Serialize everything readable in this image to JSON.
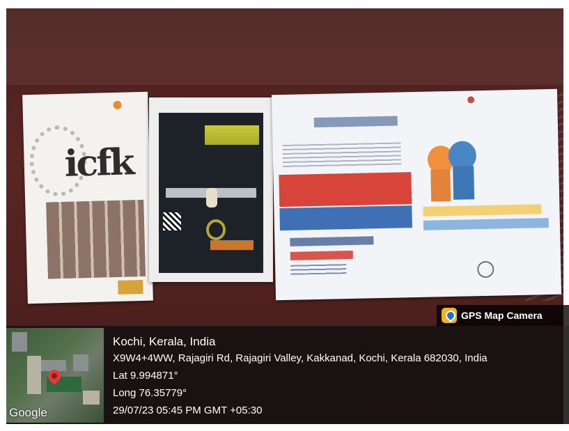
{
  "overlay": {
    "app_name": "GPS Map Camera",
    "location": "Kochi, Kerala, India",
    "address": "X9W4+4WW, Rajagiri Rd, Rajagiri Valley, Kakkanad, Kochi, Kerala 682030, India",
    "latitude": "Lat 9.994871°",
    "longitude": "Long 76.35779°",
    "timestamp": "29/07/23 05:45 PM GMT +05:30",
    "map_attribution": "Google"
  },
  "icons": {
    "app": "gps-map-camera-icon",
    "marker": "map-pin-icon"
  },
  "colors": {
    "background_wall": "#4f211f",
    "overlay_bg": "#141111",
    "pin": "#e53935",
    "app_icon": "#f2b225"
  }
}
